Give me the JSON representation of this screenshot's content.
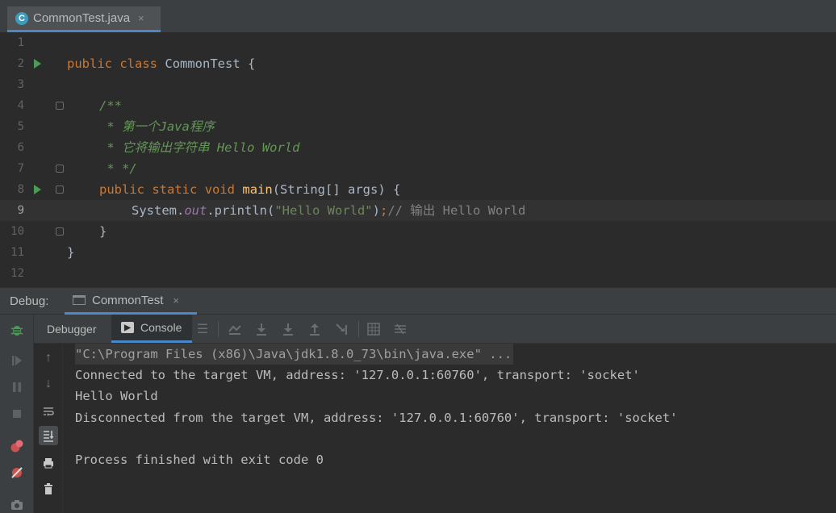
{
  "editor": {
    "tab_label": "CommonTest.java",
    "tab_close": "×",
    "class_icon_letter": "C",
    "lines": [
      {
        "num": "1"
      },
      {
        "num": "2",
        "kw1": "public",
        "kw2": "class",
        "name": "CommonTest",
        "brace": "{"
      },
      {
        "num": "3"
      },
      {
        "num": "4",
        "text": "/**"
      },
      {
        "num": "5",
        "text": " * 第一个Java程序"
      },
      {
        "num": "6",
        "text": " * 它将输出字符串 Hello World"
      },
      {
        "num": "7",
        "text": " * */"
      },
      {
        "num": "8",
        "kw1": "public",
        "kw2": "static",
        "kw3": "void",
        "fn": "main",
        "params": "(String[] args) {"
      },
      {
        "num": "9",
        "obj": "System.",
        "fld": "out",
        "call": ".println(",
        "str": "\"Hello World\"",
        "close": ")",
        "semi": ";",
        "comment": "// 输出 Hello World"
      },
      {
        "num": "10",
        "text": "}"
      },
      {
        "num": "11",
        "text": "}"
      },
      {
        "num": "12"
      }
    ]
  },
  "debug": {
    "label": "Debug:",
    "session_tab": "CommonTest",
    "session_close": "×",
    "subtabs": {
      "debugger": "Debugger",
      "console": "Console"
    },
    "console_lines": [
      "\"C:\\Program Files (x86)\\Java\\jdk1.8.0_73\\bin\\java.exe\" ...",
      "Connected to the target VM, address: '127.0.0.1:60760', transport: 'socket'",
      "Hello World",
      "Disconnected from the target VM, address: '127.0.0.1:60760', transport: 'socket'",
      "",
      "Process finished with exit code 0"
    ]
  },
  "colors": {
    "accent": "#4a88c7",
    "run": "#499c54",
    "keyword": "#cc7832",
    "doc_comment": "#629755",
    "string": "#6a8759",
    "function": "#ffc66d",
    "field": "#9876aa"
  }
}
